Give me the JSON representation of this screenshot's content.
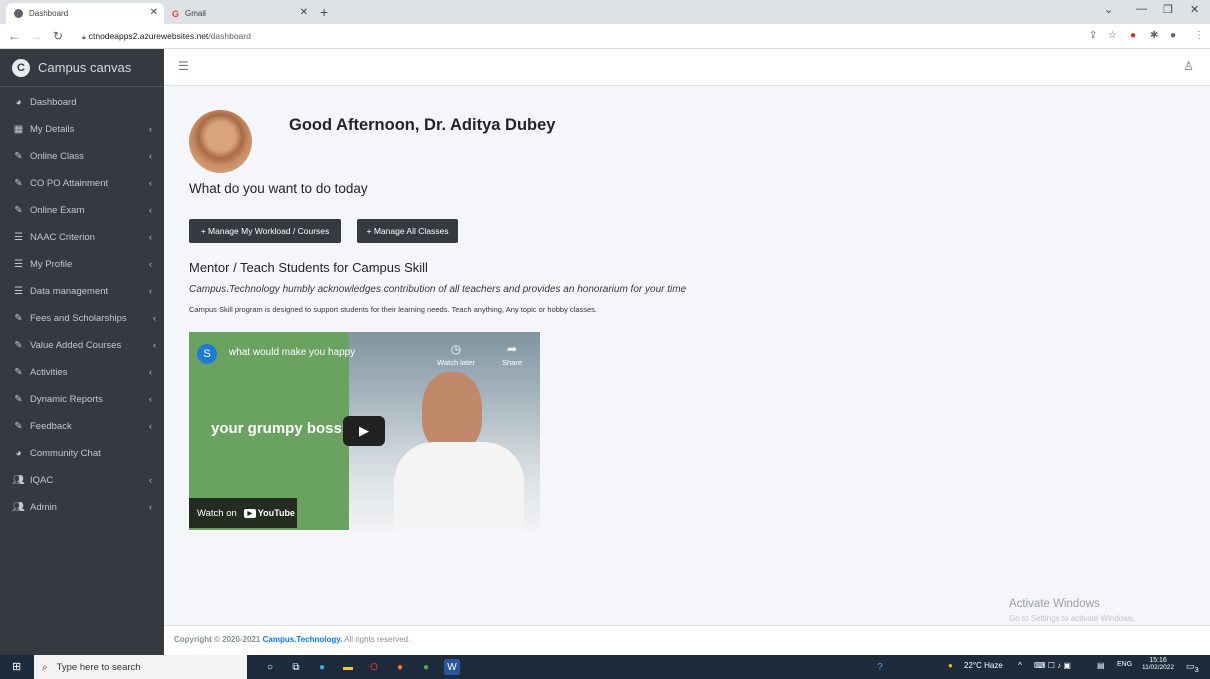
{
  "browser": {
    "tabs": [
      {
        "title": "Dashboard",
        "active": true
      },
      {
        "title": "Gmail",
        "active": false
      }
    ],
    "url_host": "ctnodeapps2.azurewebsites.net",
    "url_path": "/dashboard"
  },
  "sidebar": {
    "brand": "Campus canvas",
    "items": [
      {
        "label": "Dashboard",
        "icon": "dashboard-icon",
        "chevron": false
      },
      {
        "label": "My Details",
        "icon": "table-icon",
        "chevron": true
      },
      {
        "label": "Online Class",
        "icon": "edit-icon",
        "chevron": true
      },
      {
        "label": "CO PO Attainment",
        "icon": "edit-icon",
        "chevron": true
      },
      {
        "label": "Online Exam",
        "icon": "edit-icon",
        "chevron": true
      },
      {
        "label": "NAAC Criterion",
        "icon": "list-icon",
        "chevron": true
      },
      {
        "label": "My Profile",
        "icon": "list-icon",
        "chevron": true
      },
      {
        "label": "Data management",
        "icon": "list-icon",
        "chevron": true
      },
      {
        "label": "Fees and Scholarships",
        "icon": "edit-icon",
        "chevron": true
      },
      {
        "label": "Value Added Courses",
        "icon": "edit-icon",
        "chevron": true
      },
      {
        "label": "Activities",
        "icon": "edit-icon",
        "chevron": true
      },
      {
        "label": "Dynamic Reports",
        "icon": "edit-icon",
        "chevron": true
      },
      {
        "label": "Feedback",
        "icon": "edit-icon",
        "chevron": true
      },
      {
        "label": "Community Chat",
        "icon": "dashboard-icon",
        "chevron": false
      },
      {
        "label": "IQAC",
        "icon": "users-icon",
        "chevron": true
      },
      {
        "label": "Admin",
        "icon": "users-icon",
        "chevron": true
      }
    ]
  },
  "main": {
    "greeting": "Good Afternoon, Dr. Aditya Dubey",
    "question": "What do you want to do today",
    "buttons": {
      "workload": "+ Manage My Workload / Courses",
      "classes": "+ Manage All Classes"
    },
    "mentor_heading": "Mentor / Teach Students for Campus Skill",
    "acknowledgement": "Campus.Technology humbly acknowledges contribution of all teachers and provides an honorarium for your time",
    "info": "Campus Skill program is designed to support students for their learning needs. Teach anything, Any topic or hobby classes.",
    "video": {
      "channel_initial": "S",
      "title": "what would make you happy",
      "watch_later": "Watch later",
      "share": "Share",
      "overlay_text": "your grumpy boss?",
      "watch_on": "Watch on",
      "youtube": "YouTube"
    }
  },
  "footer": {
    "copyright": "Copyright © 2020-2021",
    "company": "Campus.Technology.",
    "rights": "All rights reserved."
  },
  "watermark": {
    "line1": "Activate Windows",
    "line2": "Go to Settings to activate Windows."
  },
  "taskbar": {
    "search_placeholder": "Type here to search",
    "weather": "22°C Haze",
    "language": "ENG",
    "time": "15:16",
    "date": "11/02/2022",
    "notification_count": "3"
  }
}
